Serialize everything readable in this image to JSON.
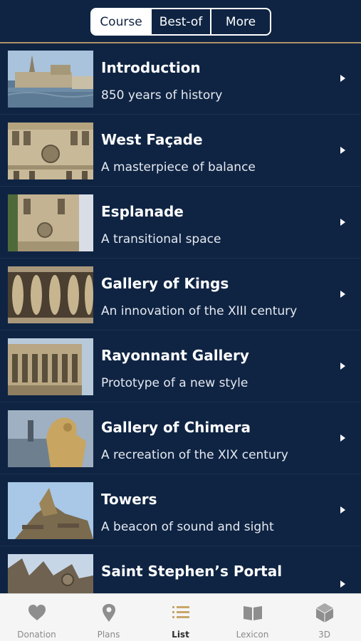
{
  "segmented_control": {
    "items": [
      "Course",
      "Best-of",
      "More"
    ],
    "selected": "Course"
  },
  "list": {
    "items": [
      {
        "title": "Introduction",
        "subtitle": "850 years of history"
      },
      {
        "title": "West Façade",
        "subtitle": "A masterpiece of balance"
      },
      {
        "title": "Esplanade",
        "subtitle": "A transitional space"
      },
      {
        "title": "Gallery of Kings",
        "subtitle": "An innovation of the XIII century"
      },
      {
        "title": "Rayonnant Gallery",
        "subtitle": "Prototype of a new style"
      },
      {
        "title": "Gallery of Chimera",
        "subtitle": "A recreation of the XIX century"
      },
      {
        "title": "Towers",
        "subtitle": "A beacon of sound and sight"
      },
      {
        "title": "Saint Stephen’s Portal",
        "subtitle": ""
      }
    ]
  },
  "tabbar": {
    "items": [
      {
        "label": "Donation",
        "icon": "heart-icon"
      },
      {
        "label": "Plans",
        "icon": "map-pin-icon"
      },
      {
        "label": "List",
        "icon": "list-icon"
      },
      {
        "label": "Lexicon",
        "icon": "book-icon"
      },
      {
        "label": "3D",
        "icon": "cube-icon"
      }
    ],
    "selected": "List"
  },
  "colors": {
    "background": "#0f2443",
    "accent": "#c9a66b",
    "tab_inactive": "#8a8a8a"
  }
}
